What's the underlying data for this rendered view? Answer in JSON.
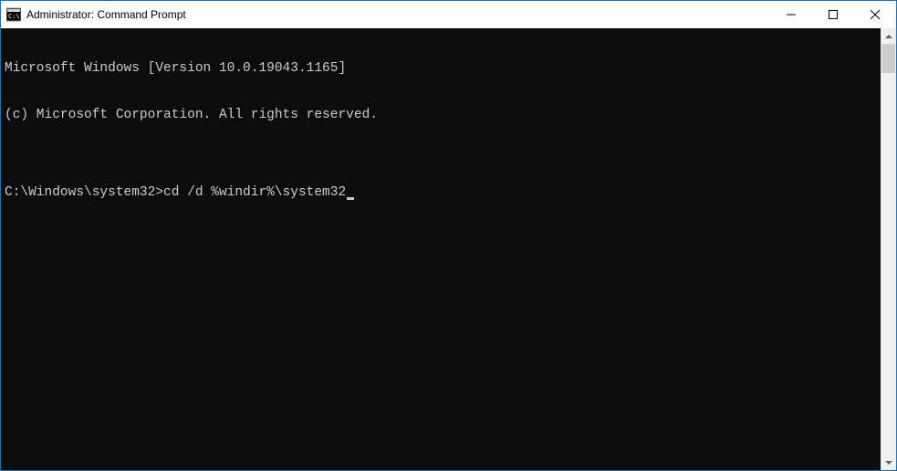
{
  "window": {
    "title": "Administrator: Command Prompt"
  },
  "console": {
    "line1": "Microsoft Windows [Version 10.0.19043.1165]",
    "line2": "(c) Microsoft Corporation. All rights reserved.",
    "blank": "",
    "prompt": "C:\\Windows\\system32>",
    "command": "cd /d %windir%\\system32"
  }
}
